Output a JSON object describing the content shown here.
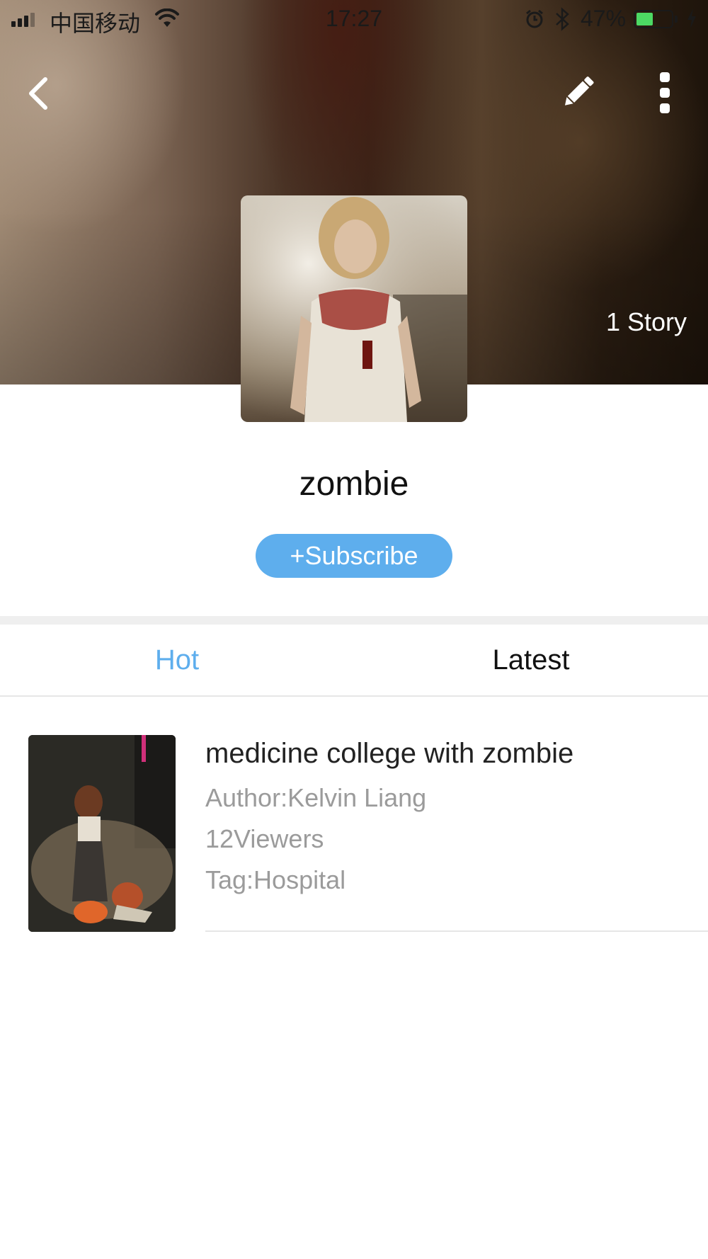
{
  "status_bar": {
    "carrier": "中国移动",
    "time": "17:27",
    "battery_percent": "47%",
    "battery_level": 0.47,
    "battery_color": "#4cd964"
  },
  "header": {
    "back_icon": "chevron-left-icon",
    "edit_icon": "pencil-icon",
    "more_icon": "more-vertical-icon",
    "story_count": "1 Story"
  },
  "topic": {
    "title": "zombie",
    "subscribe_label": "+Subscribe",
    "accent_color": "#5eaeed"
  },
  "tabs": [
    {
      "label": "Hot",
      "active": true
    },
    {
      "label": "Latest",
      "active": false
    }
  ],
  "stories": [
    {
      "title": "medicine college with zombie",
      "author": "Author:Kelvin Liang",
      "viewers": "12Viewers",
      "tag": "Tag:Hospital"
    }
  ]
}
